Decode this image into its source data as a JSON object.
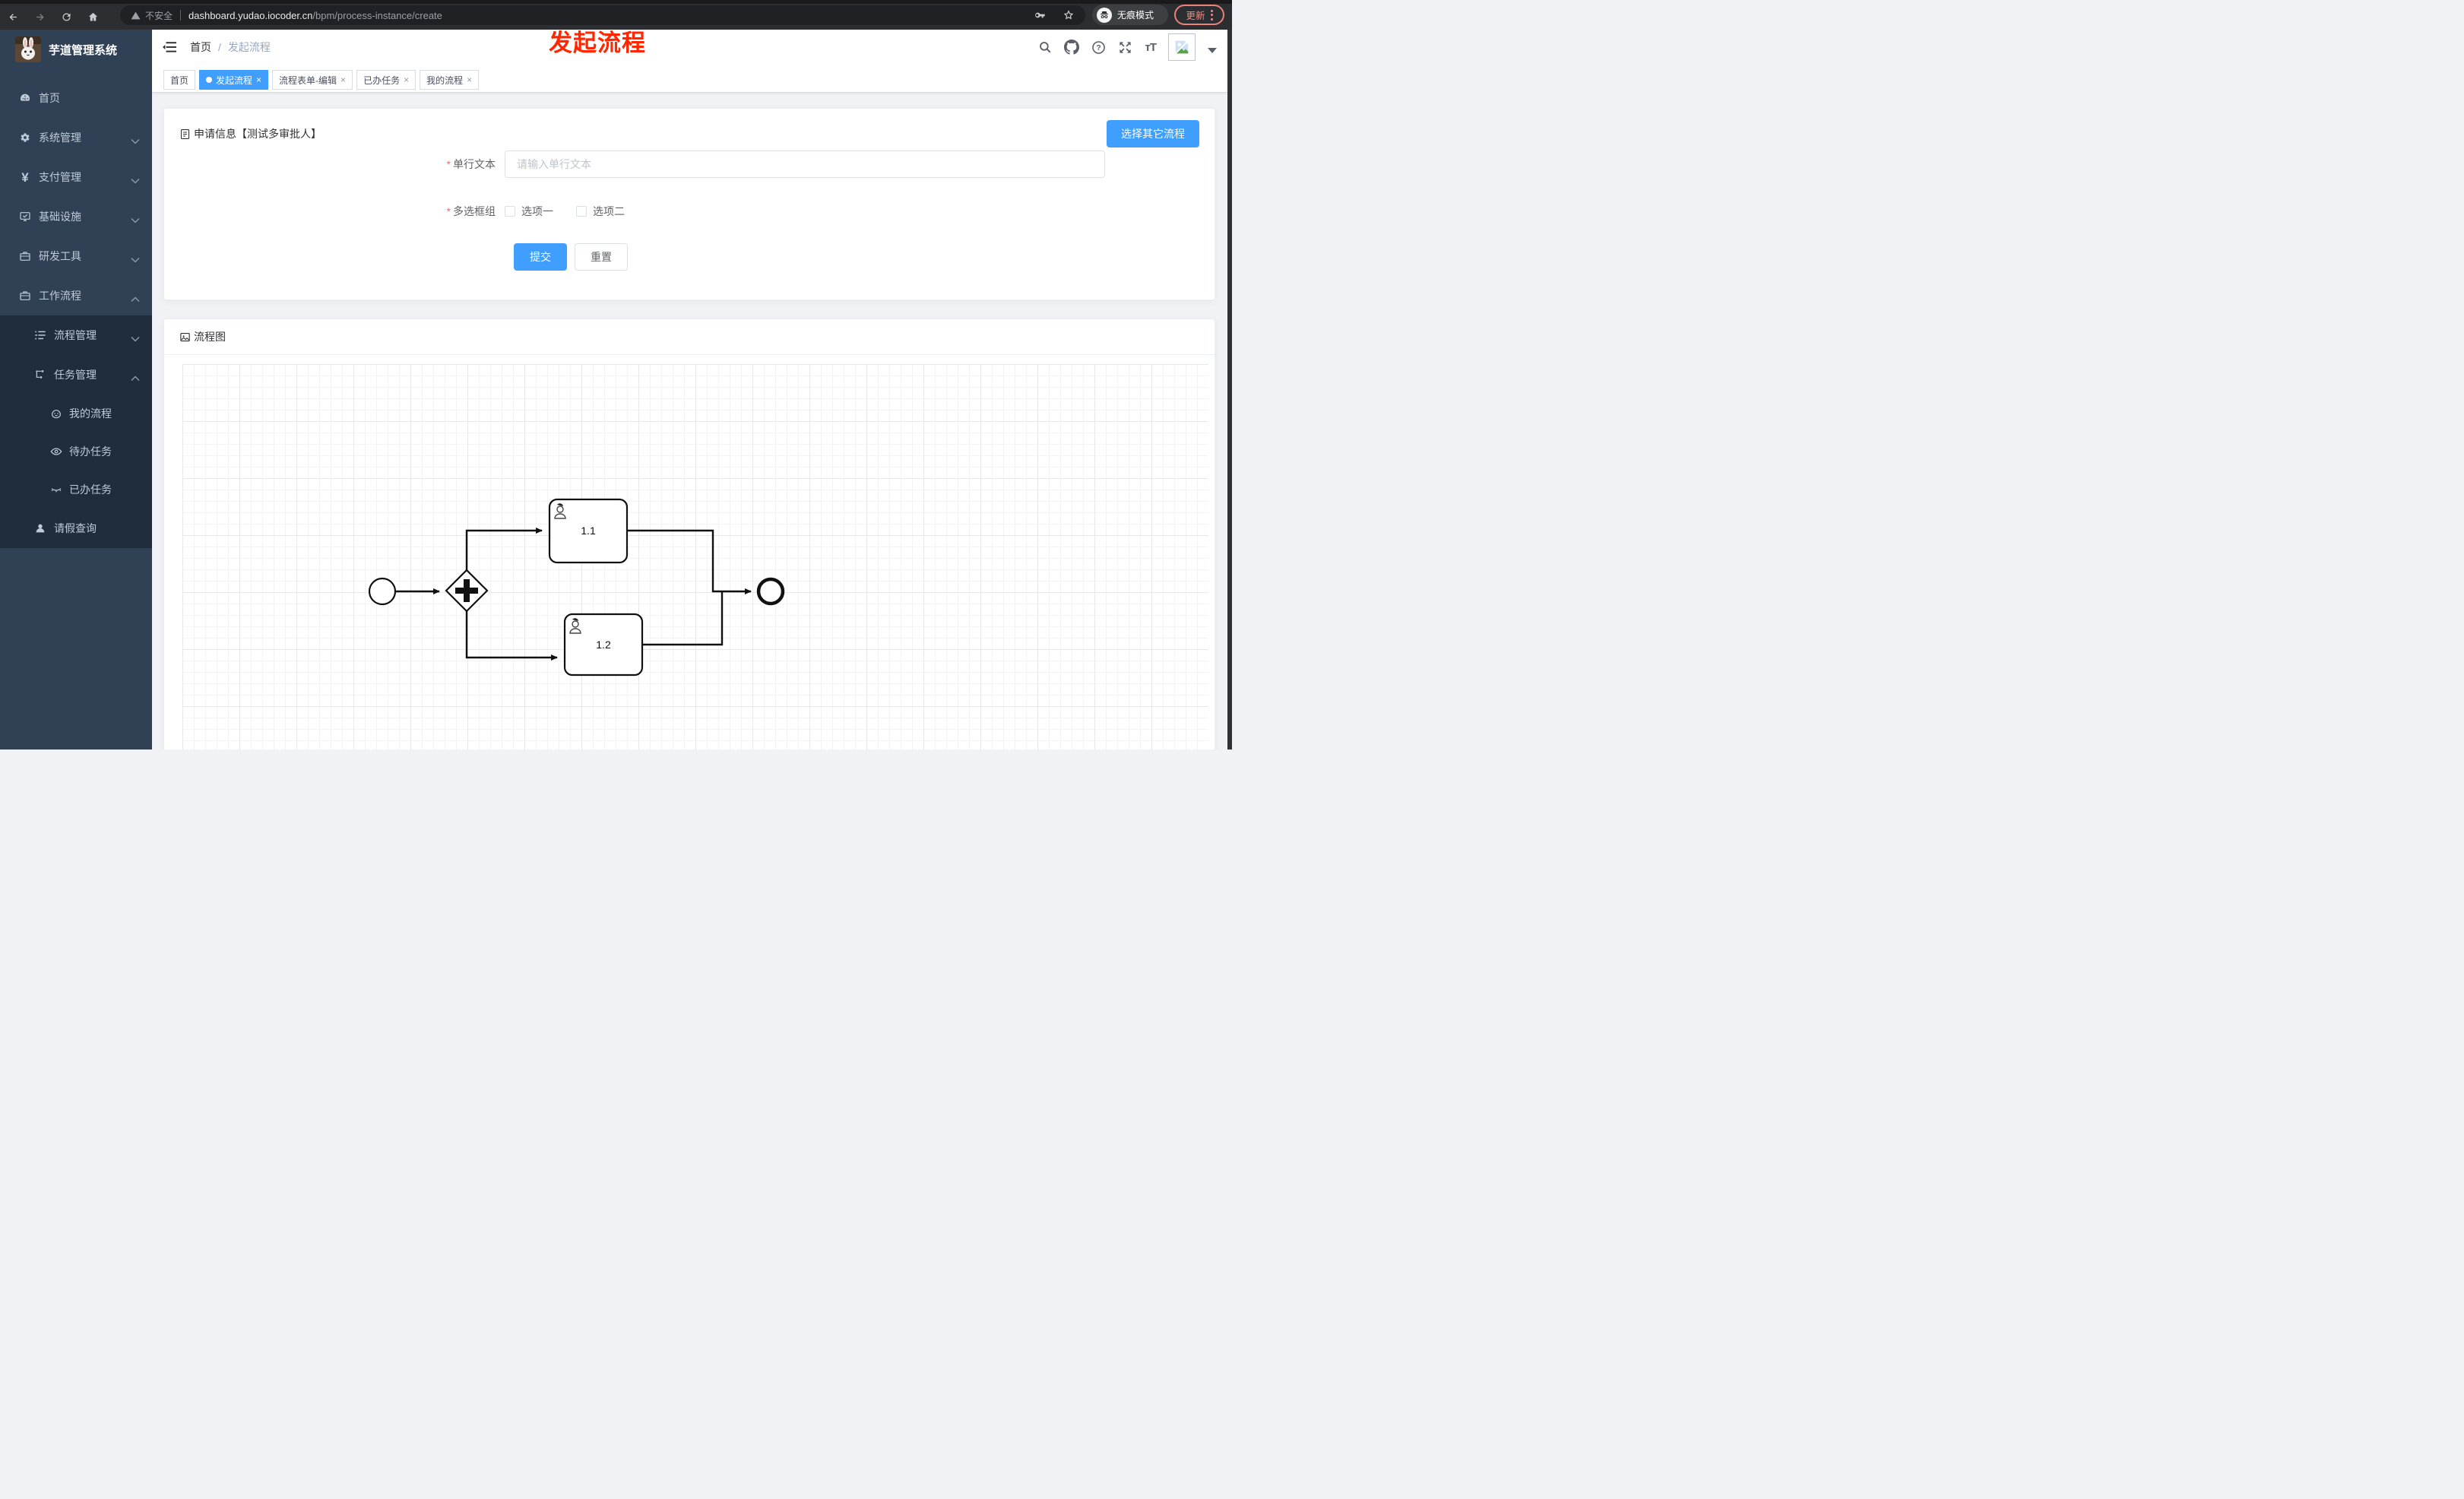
{
  "browser": {
    "security_label": "不安全",
    "url_host": "dashboard.yudao.iocoder.cn",
    "url_path": "/bpm/process-instance/create",
    "incognito_label": "无痕模式",
    "update_label": "更新"
  },
  "annotation": {
    "text": "发起流程"
  },
  "sidebar": {
    "title": "芋道管理系统",
    "items": [
      {
        "label": "首页"
      },
      {
        "label": "系统管理"
      },
      {
        "label": "支付管理"
      },
      {
        "label": "基础设施"
      },
      {
        "label": "研发工具"
      },
      {
        "label": "工作流程"
      },
      {
        "label": "流程管理"
      },
      {
        "label": "任务管理"
      },
      {
        "label": "我的流程"
      },
      {
        "label": "待办任务"
      },
      {
        "label": "已办任务"
      },
      {
        "label": "请假查询"
      }
    ]
  },
  "breadcrumb": {
    "home": "首页",
    "separator": "/",
    "current": "发起流程"
  },
  "tabs": [
    {
      "label": "首页"
    },
    {
      "label": "发起流程"
    },
    {
      "label": "流程表单-编辑"
    },
    {
      "label": "已办任务"
    },
    {
      "label": "我的流程"
    }
  ],
  "form_card": {
    "title": "申请信息【测试多审批人】",
    "select_other_button": "选择其它流程",
    "field_text": {
      "label": "单行文本",
      "placeholder": "请输入单行文本",
      "value": ""
    },
    "field_checkbox": {
      "label": "多选框组",
      "options": [
        {
          "label": "选项一"
        },
        {
          "label": "选项二"
        }
      ]
    },
    "submit_label": "提交",
    "reset_label": "重置"
  },
  "flow_card": {
    "title": "流程图",
    "tasks": [
      {
        "label": "1.1"
      },
      {
        "label": "1.2"
      }
    ]
  },
  "ui": {
    "close_glyph": "×"
  },
  "colors": {
    "primary": "#409EFF",
    "sidebar": "#304156",
    "submenu": "#1f2d3d",
    "annotation_red": "#ff2600",
    "tag_active": "#409EFF"
  }
}
